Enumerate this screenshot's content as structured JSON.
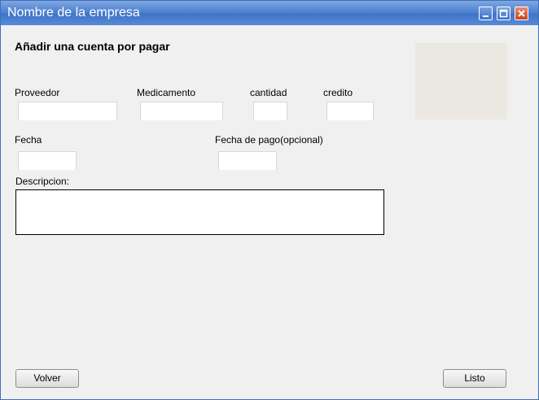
{
  "window": {
    "title": "Nombre de la empresa",
    "controls": {
      "minimize_icon": "minimize-icon",
      "maximize_icon": "maximize-icon",
      "close_icon": "close-icon"
    }
  },
  "form": {
    "heading": "Añadir una cuenta por pagar",
    "fields": {
      "proveedor": {
        "label": "Proveedor",
        "value": ""
      },
      "medicamento": {
        "label": "Medicamento",
        "value": ""
      },
      "cantidad": {
        "label": "cantidad",
        "value": ""
      },
      "credito": {
        "label": "credito",
        "value": ""
      },
      "fecha": {
        "label": "Fecha",
        "value": ""
      },
      "fecha_pago": {
        "label": "Fecha de pago(opcional)",
        "value": ""
      },
      "descripcion": {
        "label": "Descripcion:",
        "value": ""
      }
    }
  },
  "buttons": {
    "back_label": "Volver",
    "done_label": "Listo"
  },
  "colors": {
    "titlebar": "#4f82d1",
    "background": "#f0f0f0",
    "image_placeholder": "#ebe8e2"
  }
}
